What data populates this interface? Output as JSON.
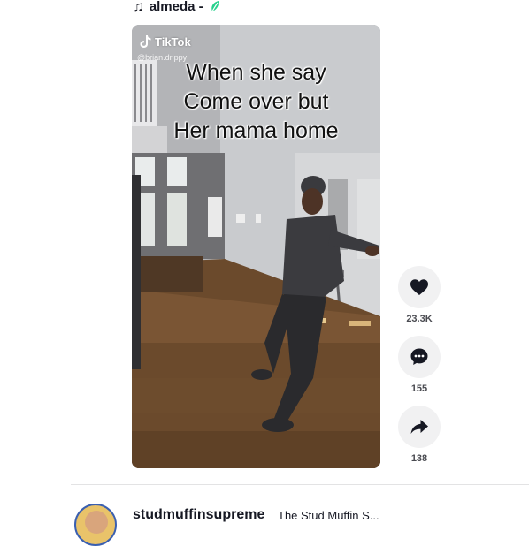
{
  "music": {
    "icon": "music-note-icon",
    "title": "almeda -",
    "badge_icon": "leaf-icon",
    "badge_color": "#25d18c"
  },
  "video": {
    "watermark": "TikTok",
    "handle": "@brian.drippy",
    "caption_lines": [
      "When she say",
      "Come over but",
      "Her mama home"
    ]
  },
  "actions": {
    "like": {
      "icon": "heart-icon",
      "count": "23.3K"
    },
    "comment": {
      "icon": "comment-icon",
      "count": "155"
    },
    "share": {
      "icon": "share-icon",
      "count": "138"
    }
  },
  "next_post": {
    "author": "studmuffinsupreme",
    "nickname": "The Stud Muffin S..."
  },
  "colors": {
    "text": "#161823",
    "count_text": "#4a4b51",
    "button_bg": "#f1f1f2"
  }
}
